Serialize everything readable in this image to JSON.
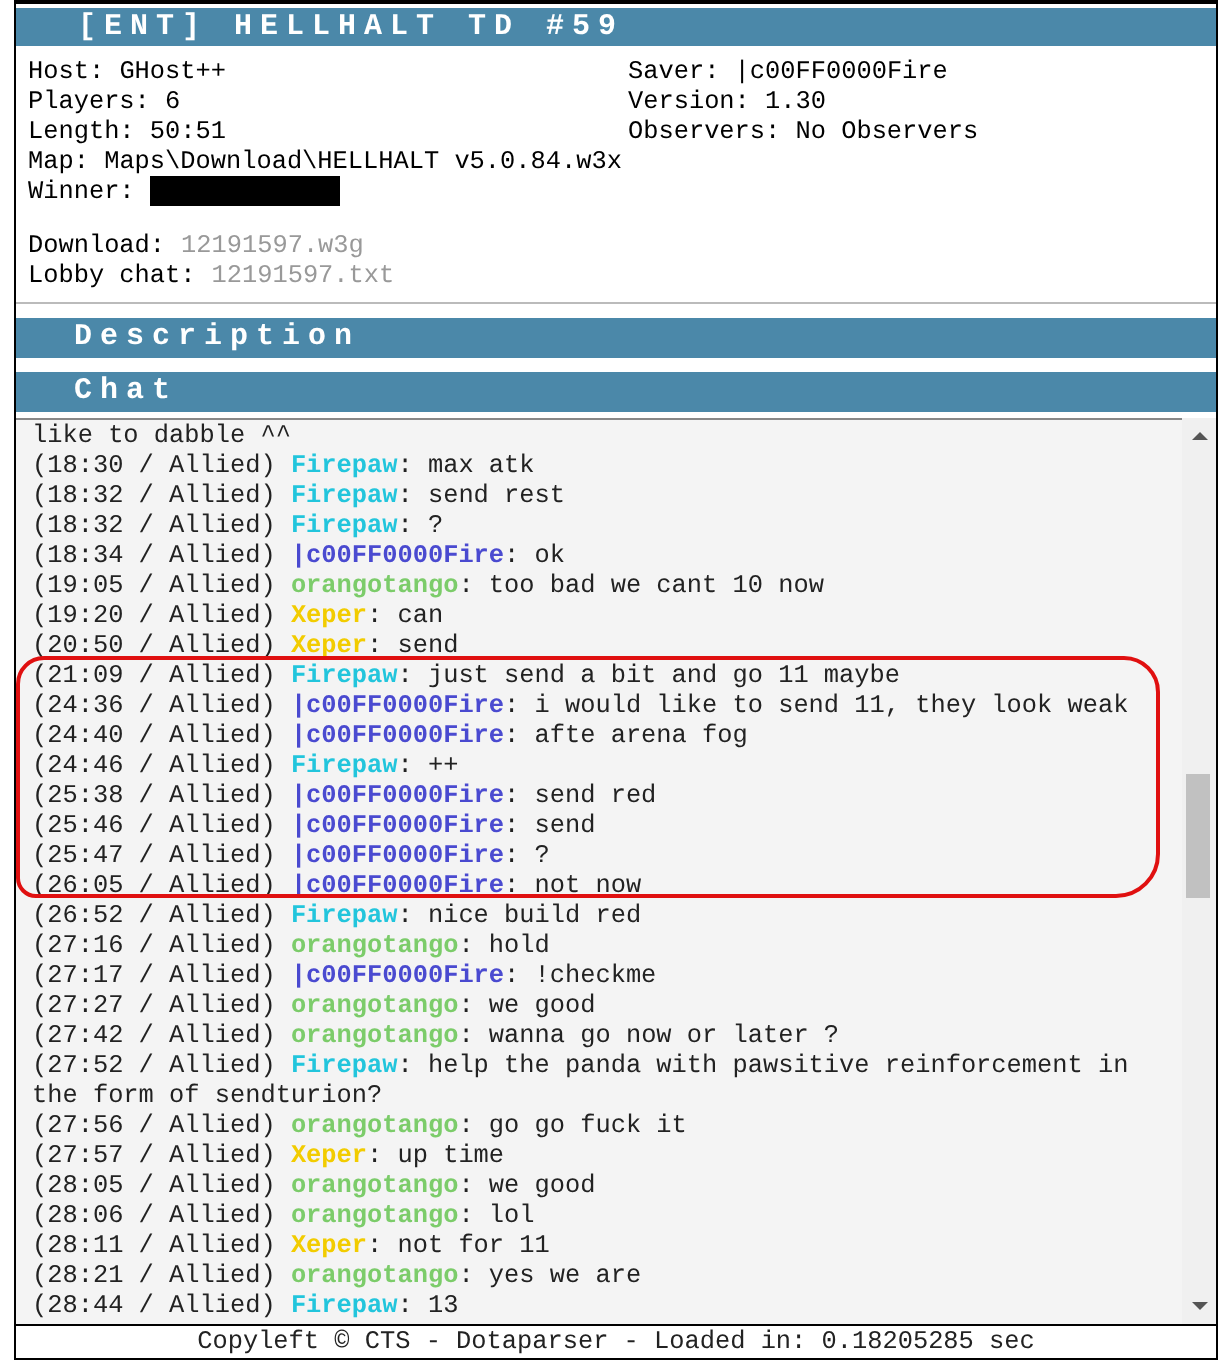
{
  "title": "[ENT] HELLHALT TD #59",
  "info_left": [
    {
      "label": "Host:",
      "value": "GHost++"
    },
    {
      "label": "Players:",
      "value": "6"
    },
    {
      "label": "Length:",
      "value": "50:51"
    }
  ],
  "info_right": [
    {
      "label": "Saver:",
      "value": "|c00FF0000Fire"
    },
    {
      "label": "Version:",
      "value": "1.30"
    },
    {
      "label": "Observers:",
      "value": "No Observers"
    }
  ],
  "map": {
    "label": "Map:",
    "value": "Maps\\Download\\HELLHALT v5.0.84.w3x"
  },
  "winner": {
    "label": "Winner:"
  },
  "files": [
    {
      "label": "Download:",
      "value": "12191597.w3g"
    },
    {
      "label": "Lobby chat:",
      "value": "12191597.txt"
    }
  ],
  "sections": [
    "Description",
    "Chat"
  ],
  "chat": [
    {
      "kind": "fragment",
      "text": "like to dabble ^^"
    },
    {
      "kind": "message",
      "time": "(18:30 / Allied)",
      "player": "Firepaw",
      "color": "#22c5dc",
      "text": ": max atk"
    },
    {
      "kind": "message",
      "time": "(18:32 / Allied)",
      "player": "Firepaw",
      "color": "#22c5dc",
      "text": ": send rest"
    },
    {
      "kind": "message",
      "time": "(18:32 / Allied)",
      "player": "Firepaw",
      "color": "#22c5dc",
      "text": ": ?"
    },
    {
      "kind": "message",
      "time": "(18:34 / Allied)",
      "player": "|c00FF0000Fire",
      "color": "#4a4ad0",
      "text": ": ok"
    },
    {
      "kind": "message",
      "time": "(19:05 / Allied)",
      "player": "orangotango",
      "color": "#7ccc6a",
      "text": ": too bad we cant 10 now"
    },
    {
      "kind": "message",
      "time": "(19:20 / Allied)",
      "player": "Xeper",
      "color": "#f2cc00",
      "text": ": can"
    },
    {
      "kind": "message",
      "time": "(20:50 / Allied)",
      "player": "Xeper",
      "color": "#f2cc00",
      "text": ": send"
    },
    {
      "kind": "message",
      "time": "(21:09 / Allied)",
      "player": "Firepaw",
      "color": "#22c5dc",
      "text": ": just send a bit and go 11 maybe"
    },
    {
      "kind": "message",
      "time": "(24:36 / Allied)",
      "player": "|c00FF0000Fire",
      "color": "#4a4ad0",
      "text": ": i would like to send 11, they look weak"
    },
    {
      "kind": "message",
      "time": "(24:40 / Allied)",
      "player": "|c00FF0000Fire",
      "color": "#4a4ad0",
      "text": ": afte arena fog"
    },
    {
      "kind": "message",
      "time": "(24:46 / Allied)",
      "player": "Firepaw",
      "color": "#22c5dc",
      "text": ": ++"
    },
    {
      "kind": "message",
      "time": "(25:38 / Allied)",
      "player": "|c00FF0000Fire",
      "color": "#4a4ad0",
      "text": ": send red"
    },
    {
      "kind": "message",
      "time": "(25:46 / Allied)",
      "player": "|c00FF0000Fire",
      "color": "#4a4ad0",
      "text": ": send"
    },
    {
      "kind": "message",
      "time": "(25:47 / Allied)",
      "player": "|c00FF0000Fire",
      "color": "#4a4ad0",
      "text": ": ?"
    },
    {
      "kind": "message",
      "time": "(26:05 / Allied)",
      "player": "|c00FF0000Fire",
      "color": "#4a4ad0",
      "text": ": not now"
    },
    {
      "kind": "message",
      "time": "(26:52 / Allied)",
      "player": "Firepaw",
      "color": "#22c5dc",
      "text": ": nice build red"
    },
    {
      "kind": "message",
      "time": "(27:16 / Allied)",
      "player": "orangotango",
      "color": "#7ccc6a",
      "text": ": hold"
    },
    {
      "kind": "message",
      "time": "(27:17 / Allied)",
      "player": "|c00FF0000Fire",
      "color": "#4a4ad0",
      "text": ": !checkme"
    },
    {
      "kind": "message",
      "time": "(27:27 / Allied)",
      "player": "orangotango",
      "color": "#7ccc6a",
      "text": ": we good"
    },
    {
      "kind": "message",
      "time": "(27:42 / Allied)",
      "player": "orangotango",
      "color": "#7ccc6a",
      "text": ": wanna go now or later ?"
    },
    {
      "kind": "message",
      "time": "(27:52 / Allied)",
      "player": "Firepaw",
      "color": "#22c5dc",
      "text": ": help the panda with pawsitive reinforcement in the form of sendturion?"
    },
    {
      "kind": "message",
      "time": "(27:56 / Allied)",
      "player": "orangotango",
      "color": "#7ccc6a",
      "text": ": go go fuck it"
    },
    {
      "kind": "message",
      "time": "(27:57 / Allied)",
      "player": "Xeper",
      "color": "#f2cc00",
      "text": ": up time"
    },
    {
      "kind": "message",
      "time": "(28:05 / Allied)",
      "player": "orangotango",
      "color": "#7ccc6a",
      "text": ": we good"
    },
    {
      "kind": "message",
      "time": "(28:06 / Allied)",
      "player": "orangotango",
      "color": "#7ccc6a",
      "text": ": lol"
    },
    {
      "kind": "message",
      "time": "(28:11 / Allied)",
      "player": "Xeper",
      "color": "#f2cc00",
      "text": ": not for 11"
    },
    {
      "kind": "message",
      "time": "(28:21 / Allied)",
      "player": "orangotango",
      "color": "#7ccc6a",
      "text": ": yes we are"
    },
    {
      "kind": "message",
      "time": "(28:44 / Allied)",
      "player": "Firepaw",
      "color": "#22c5dc",
      "text": ": 13"
    }
  ],
  "footer": "Copyleft © CTS - Dotaparser - Loaded in: 0.18205285 sec"
}
